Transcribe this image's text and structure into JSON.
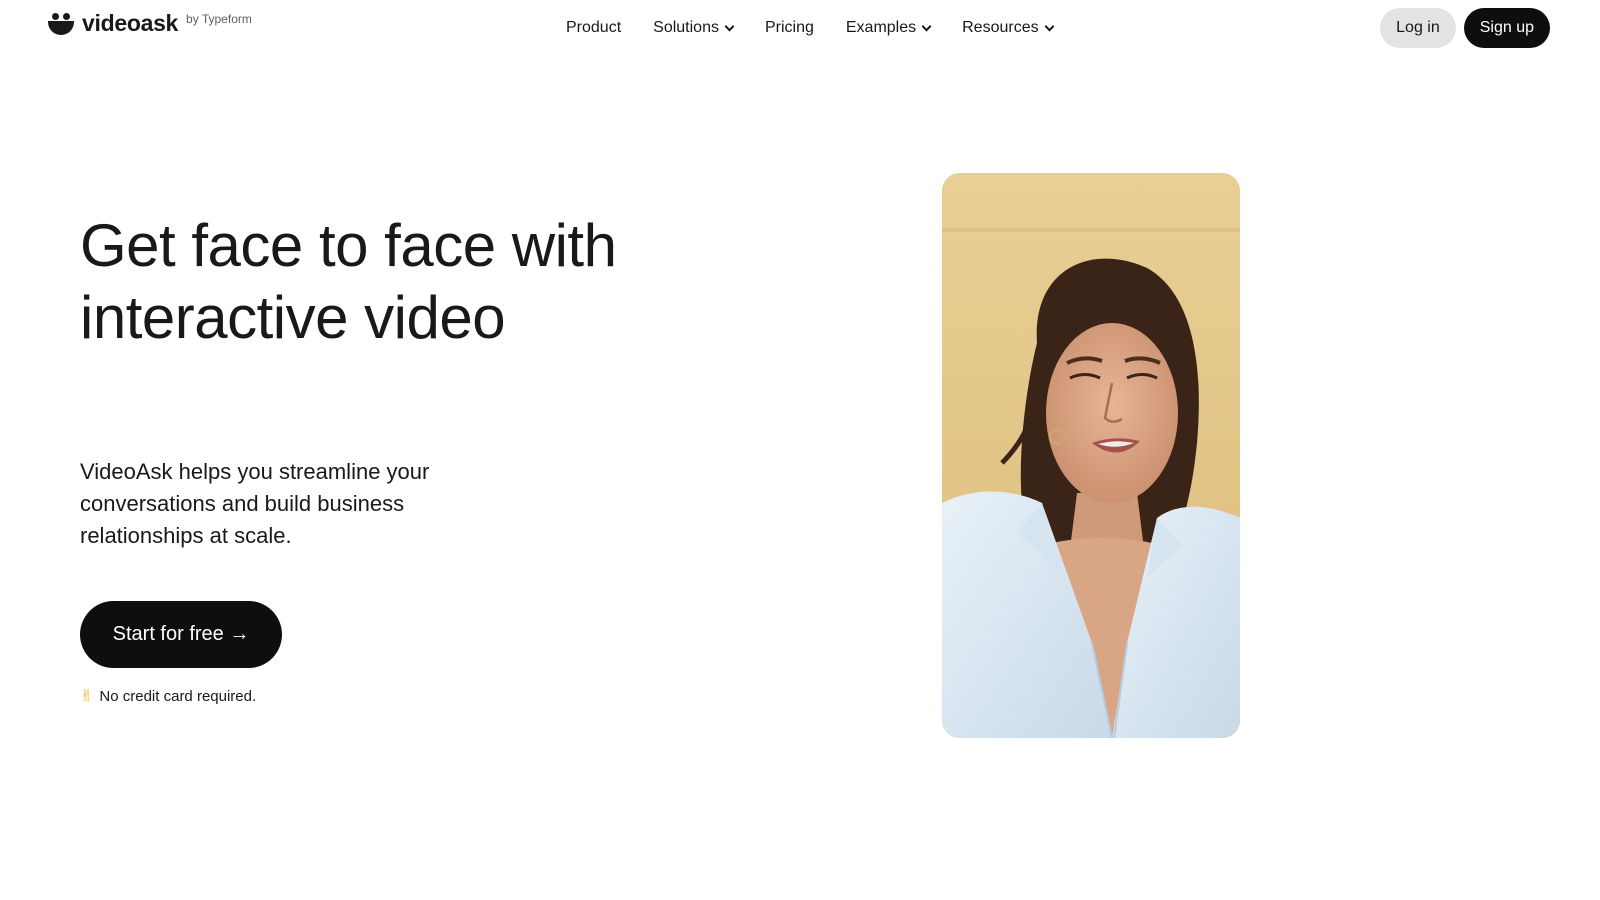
{
  "header": {
    "logo": {
      "wordmark": "videoask",
      "byline": "by Typeform",
      "icon": "videoask-smile-logo-icon"
    },
    "nav": [
      {
        "label": "Product",
        "has_dropdown": false
      },
      {
        "label": "Solutions",
        "has_dropdown": true
      },
      {
        "label": "Pricing",
        "has_dropdown": false
      },
      {
        "label": "Examples",
        "has_dropdown": true
      },
      {
        "label": "Resources",
        "has_dropdown": true
      }
    ],
    "login_label": "Log in",
    "signup_label": "Sign up"
  },
  "hero": {
    "title": "Get face to face with interactive video",
    "subtitle": "VideoAsk helps you streamline your conversations and build business relationships at scale.",
    "cta_label": "Start for free →",
    "note_emoji": "✌",
    "note_text": "No credit card required."
  },
  "colors": {
    "text": "#191919",
    "button_dark": "#0e0e0e",
    "button_light": "#e3e3e3",
    "video_bg": "#e6c98c"
  }
}
